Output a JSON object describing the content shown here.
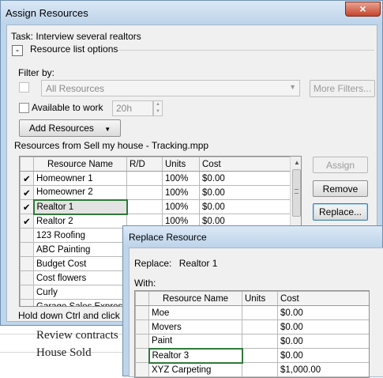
{
  "window": {
    "title": "Assign Resources",
    "close_glyph": "×"
  },
  "task": {
    "prefix": "Task:",
    "name": "Interview several realtors"
  },
  "resource_list_options": {
    "toggle": "-",
    "label": "Resource list options"
  },
  "filter": {
    "label": "Filter by:",
    "dropdown_value": "All Resources",
    "more_filters_label": "More Filters...",
    "available_label": "Available to work",
    "available_value": "20h"
  },
  "add_resources_label": "Add Resources",
  "resources_caption": "Resources from Sell my house - Tracking.mpp",
  "grid": {
    "headers": [
      "Resource Name",
      "R/D",
      "Units",
      "Cost"
    ],
    "rows": [
      {
        "check": "✔",
        "name": "Homeowner 1",
        "rd": "",
        "units": "100%",
        "cost": "$0.00"
      },
      {
        "check": "✔",
        "name": "Homeowner 2",
        "rd": "",
        "units": "100%",
        "cost": "$0.00"
      },
      {
        "check": "✔",
        "name": "Realtor 1",
        "rd": "",
        "units": "100%",
        "cost": "$0.00"
      },
      {
        "check": "✔",
        "name": "Realtor 2",
        "rd": "",
        "units": "100%",
        "cost": "$0.00"
      },
      {
        "check": "",
        "name": "123 Roofing",
        "rd": "",
        "units": "",
        "cost": ""
      },
      {
        "check": "",
        "name": "ABC Painting",
        "rd": "",
        "units": "",
        "cost": ""
      },
      {
        "check": "",
        "name": "Budget Cost",
        "rd": "",
        "units": "",
        "cost": ""
      },
      {
        "check": "",
        "name": "Cost flowers",
        "rd": "",
        "units": "",
        "cost": ""
      },
      {
        "check": "",
        "name": "Curly",
        "rd": "",
        "units": "",
        "cost": ""
      },
      {
        "check": "",
        "name": "Garage Sales Express",
        "rd": "",
        "units": "",
        "cost": ""
      }
    ]
  },
  "buttons": {
    "assign": "Assign",
    "remove": "Remove",
    "replace": "Replace..."
  },
  "hint": "Hold down Ctrl and click t",
  "background_tasks": [
    "Review contracts",
    "House Sold"
  ],
  "replace_dialog": {
    "title": "Replace Resource",
    "replace_label": "Replace:",
    "replace_value": "Realtor 1",
    "with_label": "With:",
    "headers": [
      "Resource Name",
      "Units",
      "Cost"
    ],
    "rows": [
      {
        "name": "Moe",
        "units": "",
        "cost": "$0.00"
      },
      {
        "name": "Movers",
        "units": "",
        "cost": "$0.00"
      },
      {
        "name": "Paint",
        "units": "",
        "cost": "$0.00"
      },
      {
        "name": "Realtor 3",
        "units": "",
        "cost": "$0.00"
      },
      {
        "name": "XYZ Carpeting",
        "units": "",
        "cost": "$1,000.00"
      }
    ]
  }
}
